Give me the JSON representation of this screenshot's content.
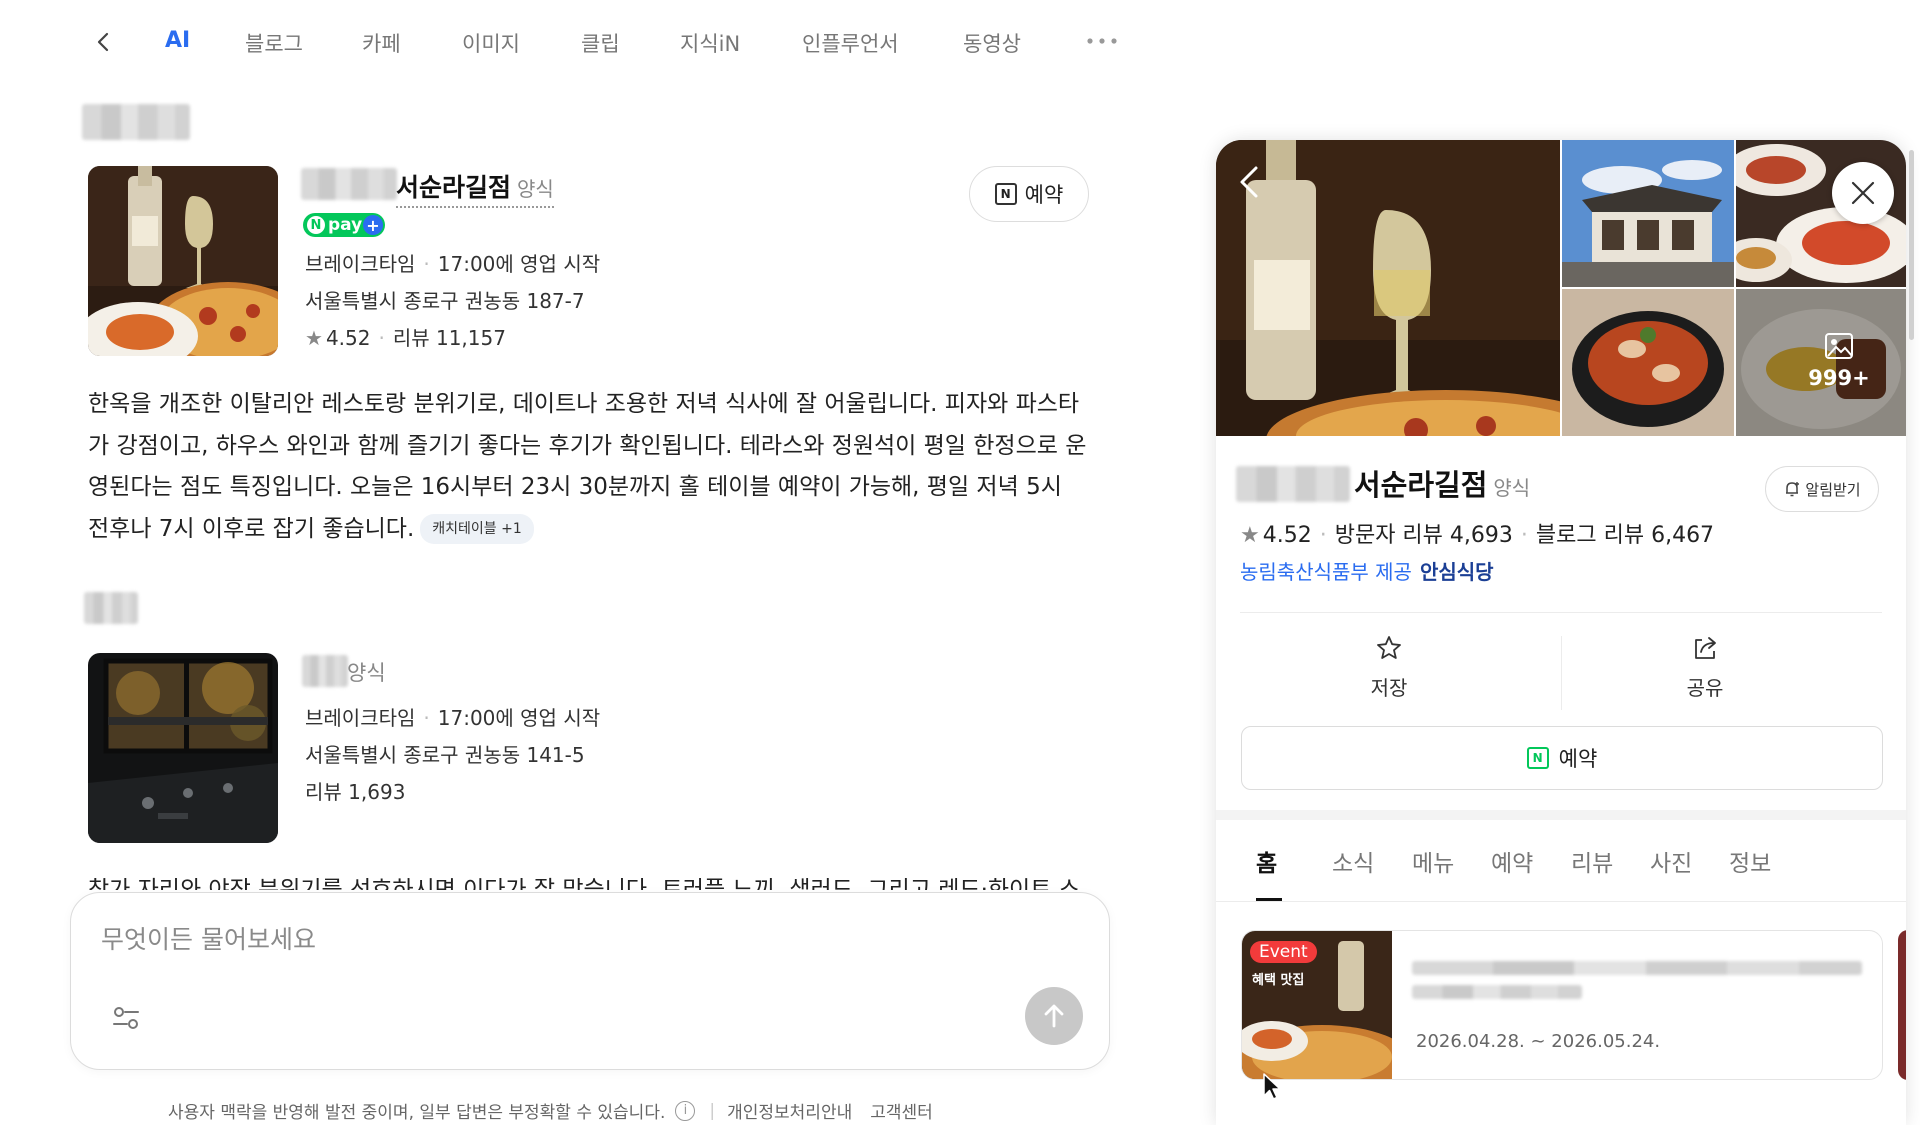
{
  "nav": {
    "tabs": [
      "AI",
      "블로그",
      "카페",
      "이미지",
      "클립",
      "지식iN",
      "인플루언서",
      "동영상"
    ],
    "active_tab": "AI",
    "accent_color": "#2a6cf0"
  },
  "results": [
    {
      "name": "서순라길점",
      "category": "양식",
      "npay_label": "pay",
      "breaktime_label": "브레이크타임",
      "open_info": "17:00에 영업 시작",
      "address": "서울특별시 종로구 권농동 187-7",
      "rating": "4.52",
      "reviews": "리뷰 11,157",
      "reserve_label": "예약",
      "summary": "한옥을 개조한 이탈리안 레스토랑 분위기로, 데이트나 조용한 저녁 식사에 잘 어울립니다. 피자와 파스타가 강점이고, 하우스 와인과 함께 즐기기 좋다는 후기가 확인됩니다. 테라스와 정원석이 평일 한정으로 운영된다는 점도 특징입니다. 오늘은 16시부터 23시 30분까지 홀 테이블 예약이 가능해, 평일 저녁 5시 전후나 7시 이후로 잡기 좋습니다.",
      "source_chip": "캐치테이블 +1"
    },
    {
      "category": "양식",
      "breaktime_label": "브레이크타임",
      "open_info": "17:00에 영업 시작",
      "address": "서울특별시 종로구 권농동 141-5",
      "reviews": "리뷰 1,693",
      "summary_cut": "창가 자리와 야장 분위기를 선호하시면 이다가 잘 맞습니다. 트러플 느끼, 샐러드, 그리고 레드·화이트 스"
    }
  ],
  "ask": {
    "placeholder": "무엇이든 물어보세요"
  },
  "footer": {
    "disclaimer": "사용자 맥락을 반영해 발전 중이며, 일부 답변은 부정확할 수 있습니다.",
    "info_glyph": "i",
    "privacy": "개인정보처리안내",
    "support": "고객센터"
  },
  "panel": {
    "photo_count": "999+",
    "name": "서순라길점",
    "category": "양식",
    "alarm_label": "알림받기",
    "rating": "4.52",
    "visitor_reviews": "방문자 리뷰 4,693",
    "blog_reviews": "블로그 리뷰 6,467",
    "cert_source": "농림축산식품부 제공",
    "cert_name": "안심식당",
    "save_label": "저장",
    "share_label": "공유",
    "reserve_label": "예약",
    "tabs": [
      "홈",
      "소식",
      "메뉴",
      "예약",
      "리뷰",
      "사진",
      "정보"
    ],
    "active_tab": "홈",
    "event_badge": "Event",
    "event_sub": "혜택 맛집",
    "event_period": "2026.04.28. ~ 2026.05.24."
  }
}
